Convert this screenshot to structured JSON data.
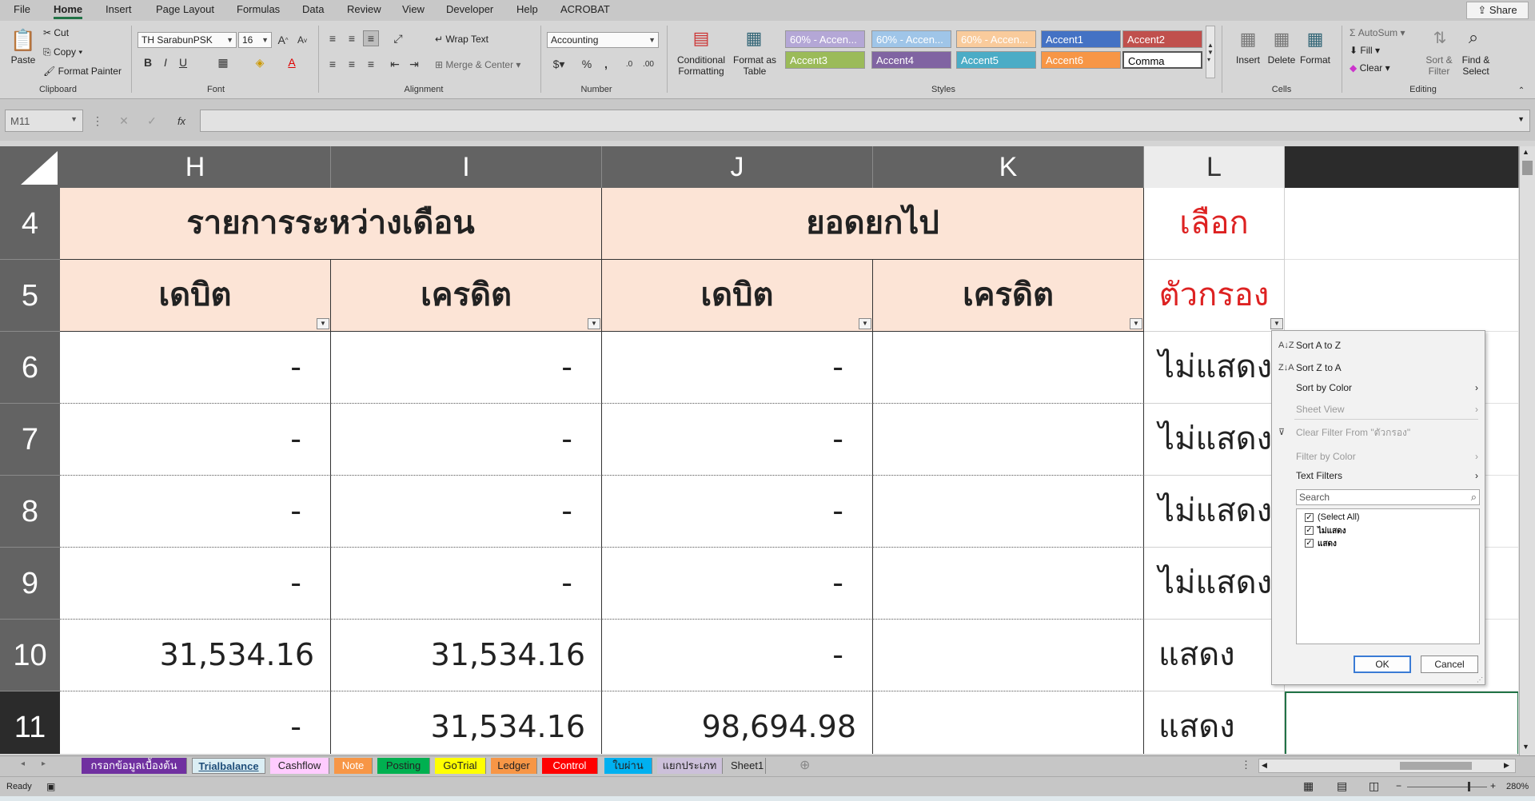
{
  "menu": {
    "items": [
      "File",
      "Home",
      "Insert",
      "Page Layout",
      "Formulas",
      "Data",
      "Review",
      "View",
      "Developer",
      "Help",
      "ACROBAT"
    ],
    "active": "Home",
    "share": "Share"
  },
  "ribbon": {
    "clipboard": {
      "paste": "Paste",
      "cut": "Cut",
      "copy": "Copy",
      "format_painter": "Format Painter",
      "label": "Clipboard"
    },
    "font": {
      "name": "TH SarabunPSK",
      "size": "16",
      "bold": "B",
      "italic": "I",
      "underline": "U",
      "label": "Font"
    },
    "alignment": {
      "wrap_text": "Wrap Text",
      "merge_center": "Merge & Center",
      "label": "Alignment"
    },
    "number": {
      "format": "Accounting",
      "label": "Number"
    },
    "styles": {
      "conditional_formatting": "Conditional Formatting",
      "format_as_table": "Format as Table",
      "cells": [
        {
          "text": "60% - Accen...",
          "bg": "#b4a7d6",
          "fg": "#ffffff"
        },
        {
          "text": "60% - Accen...",
          "bg": "#9fc5e8",
          "fg": "#ffffff"
        },
        {
          "text": "60% - Accen...",
          "bg": "#f9cb9c",
          "fg": "#ffffff"
        },
        {
          "text": "Accent1",
          "bg": "#4472c4",
          "fg": "#ffffff"
        },
        {
          "text": "Accent2",
          "bg": "#c0504d",
          "fg": "#ffffff"
        },
        {
          "text": "Accent3",
          "bg": "#9bbb59",
          "fg": "#ffffff"
        },
        {
          "text": "Accent4",
          "bg": "#8064a2",
          "fg": "#ffffff"
        },
        {
          "text": "Accent5",
          "bg": "#4bacc6",
          "fg": "#ffffff"
        },
        {
          "text": "Accent6",
          "bg": "#f79646",
          "fg": "#ffffff"
        },
        {
          "text": "Comma",
          "bg": "#ffffff",
          "fg": "#000000"
        }
      ],
      "label": "Styles"
    },
    "cells": {
      "insert": "Insert",
      "delete": "Delete",
      "format": "Format",
      "label": "Cells"
    },
    "editing": {
      "autosum": "AutoSum",
      "fill": "Fill",
      "clear": "Clear",
      "sort_filter": "Sort & Filter",
      "find_select": "Find & Select",
      "label": "Editing"
    }
  },
  "formula_bar": {
    "name_box": "M11",
    "fx": "fx",
    "value": ""
  },
  "sheet": {
    "columns": [
      "H",
      "I",
      "J",
      "K",
      "L"
    ],
    "rows": [
      {
        "num": "4",
        "cells": {
          "HI": "รายการระหว่างเดือน",
          "JK": "ยอดยกไป",
          "L": "เลือก"
        }
      },
      {
        "num": "5",
        "cells": {
          "H": "เดบิต",
          "I": "เครดิต",
          "J": "เดบิต",
          "K": "เครดิต",
          "L": "ตัวกรอง"
        }
      },
      {
        "num": "6",
        "cells": {
          "H": "-",
          "I": "-",
          "J": "-",
          "K": "",
          "L": "ไม่แสดง"
        }
      },
      {
        "num": "7",
        "cells": {
          "H": "-",
          "I": "-",
          "J": "-",
          "K": "",
          "L": "ไม่แสดง"
        }
      },
      {
        "num": "8",
        "cells": {
          "H": "-",
          "I": "-",
          "J": "-",
          "K": "",
          "L": "ไม่แสดง"
        }
      },
      {
        "num": "9",
        "cells": {
          "H": "-",
          "I": "-",
          "J": "-",
          "K": "",
          "L": "ไม่แสดง"
        }
      },
      {
        "num": "10",
        "cells": {
          "H": "31,534.16",
          "I": "31,534.16",
          "J": "-",
          "K": "",
          "L": "แสดง"
        }
      },
      {
        "num": "11",
        "cells": {
          "H": "-",
          "I": "31,534.16",
          "J": "98,694.98",
          "K": "",
          "L": "แสดง"
        }
      }
    ]
  },
  "filter_menu": {
    "sort_az": "Sort A to Z",
    "sort_za": "Sort Z to A",
    "sort_by_color": "Sort by Color",
    "sheet_view": "Sheet View",
    "clear_filter": "Clear Filter From \"ตัวกรอง\"",
    "filter_by_color": "Filter by Color",
    "text_filters": "Text Filters",
    "search_placeholder": "Search",
    "options": [
      "(Select All)",
      "ไม่แสดง",
      "แสดง"
    ],
    "ok": "OK",
    "cancel": "Cancel"
  },
  "tabs": [
    {
      "name": "กรอกข้อมูลเบื้องต้น",
      "bg": "#7030a0",
      "fg": "#ffffff"
    },
    {
      "name": "Trialbalance",
      "bg": "#dbeef4",
      "fg": "#1f4e79"
    },
    {
      "name": "Cashflow",
      "bg": "#ffccff",
      "fg": "#222222"
    },
    {
      "name": "Note",
      "bg": "#f79646",
      "fg": "#ffffff"
    },
    {
      "name": "Posting",
      "bg": "#00b050",
      "fg": "#222222"
    },
    {
      "name": "GoTrial",
      "bg": "#ffff00",
      "fg": "#222222"
    },
    {
      "name": "Ledger",
      "bg": "#f79646",
      "fg": "#222222"
    },
    {
      "name": "Control",
      "bg": "#ff0000",
      "fg": "#ffffff"
    },
    {
      "name": "ใบผ่าน",
      "bg": "#00b0f0",
      "fg": "#222222"
    },
    {
      "name": "แยกประเภท",
      "bg": "#ccc0da",
      "fg": "#222222"
    },
    {
      "name": "Sheet1",
      "bg": "#c6c6c6",
      "fg": "#222222"
    }
  ],
  "status": {
    "ready": "Ready",
    "zoom": "280%"
  }
}
